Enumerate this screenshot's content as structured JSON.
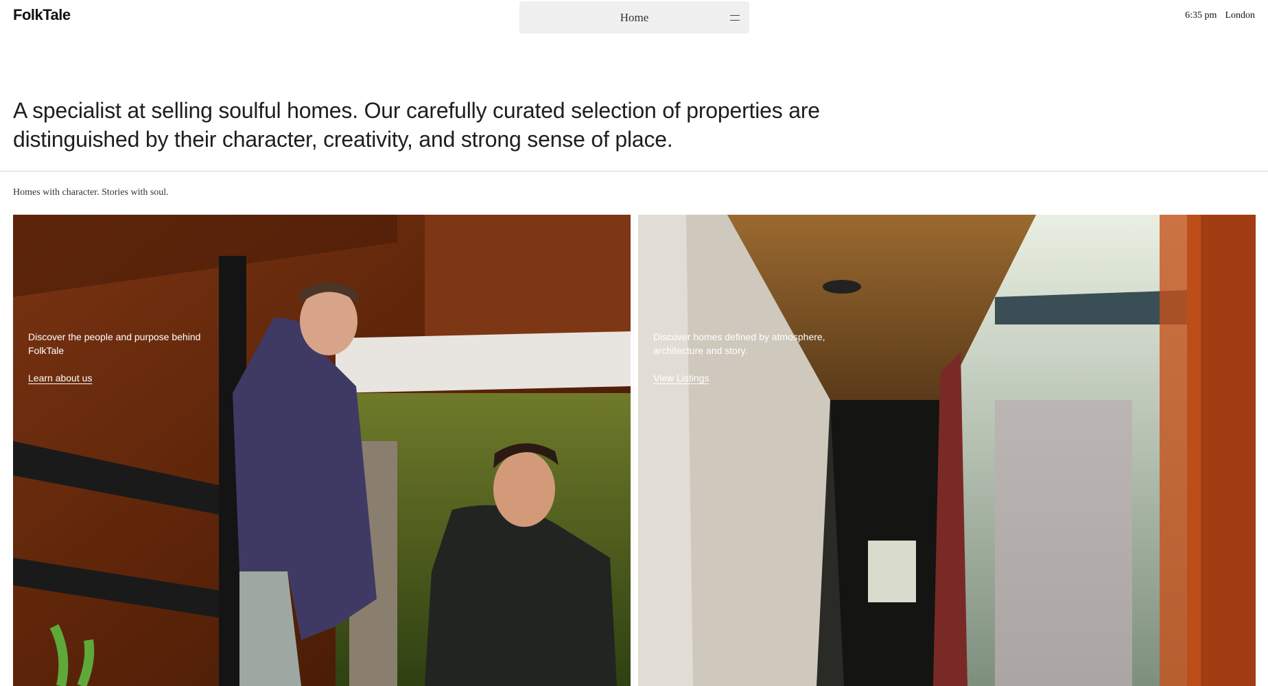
{
  "header": {
    "logo": "FolkTale",
    "nav_label": "Home",
    "menu_icon": "hamburger-menu-icon",
    "time": "6:35 pm",
    "location": "London"
  },
  "intro": {
    "text": "A specialist at selling soulful homes. Our carefully curated selection of properties are distinguished by their character, creativity, and strong sense of place."
  },
  "tagline": "Homes with character. Stories with soul.",
  "cards": [
    {
      "description": "Discover the people and purpose behind FolkTale",
      "link": "Learn about us"
    },
    {
      "description": "Discover homes defined by atmosphere, architecture and story.",
      "link": "View Listings"
    }
  ],
  "colors": {
    "background": "#ffffff",
    "nav_pill": "#f0f0f0",
    "text": "#1e1e1e",
    "divider": "#d6d6d6"
  }
}
